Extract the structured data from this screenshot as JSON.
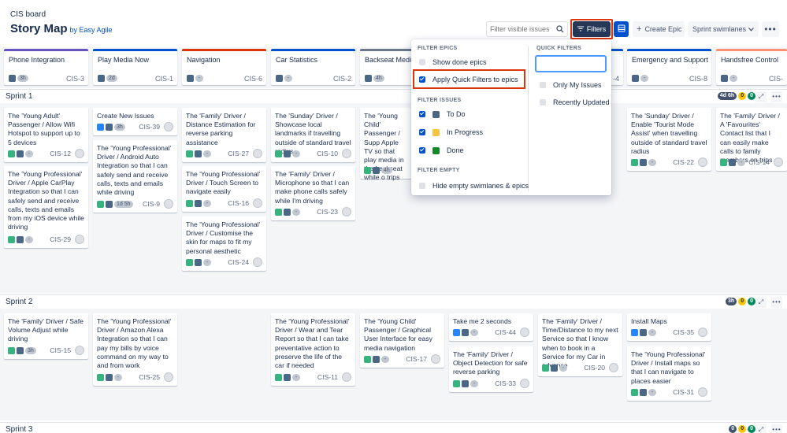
{
  "header": {
    "board_name": "CIS board",
    "title": "Story Map",
    "by_line": "by Easy Agile",
    "search_placeholder": "Filter visible issues",
    "filters_label": "Filters",
    "create_epic_label": "Create Epic",
    "swimlanes_label": "Sprint swimlanes"
  },
  "epics": [
    {
      "name": "Phone Integration",
      "color": "#6554c0",
      "pill": "3h",
      "key": "CIS-3"
    },
    {
      "name": "Play Media Now",
      "color": "#0052cc",
      "pill": "2d",
      "key": "CIS-1"
    },
    {
      "name": "Navigation",
      "color": "#de350b",
      "pill": "-",
      "key": "CIS-6"
    },
    {
      "name": "Car Statistics",
      "color": "#0052cc",
      "pill": "-",
      "key": "CIS-2"
    },
    {
      "name": "Backseat Media",
      "color": "#6b778c",
      "pill": "4h",
      "key": ""
    },
    {
      "name": "",
      "color": "#0052cc",
      "pill": "",
      "key": "-4"
    },
    {
      "name": "Emergency and Support",
      "color": "#0052cc",
      "pill": "-",
      "key": "CIS-8"
    },
    {
      "name": "Handsfree Control",
      "color": "#ff8f73",
      "pill": "-",
      "key": "CIS-"
    }
  ],
  "sprints": [
    {
      "name": "Sprint 1",
      "badges": [
        "4d 6h",
        "0",
        "0"
      ]
    },
    {
      "name": "Sprint 2",
      "badges": [
        "3h",
        "0",
        "0"
      ]
    },
    {
      "name": "Sprint 3",
      "badges": [
        "0",
        "0",
        "0"
      ]
    }
  ],
  "cards": {
    "c1": {
      "text": "The 'Young Adult' Passenger / Allow Wifi Hotspot to support up to 5 devices",
      "key": "CIS-12",
      "pill": "-"
    },
    "c2": {
      "text": "The 'Young Professional' Driver / Apple CarPlay Integration so that I can safely send and receive calls, texts and emails from my iOS device while driving",
      "key": "CIS-29",
      "pill": "-"
    },
    "c3": {
      "text": "Create New Issues",
      "key": "CIS-39",
      "pill": "3h"
    },
    "c4": {
      "text": "The 'Young Professional' Driver / Android Auto Integration so that I can safely send and receive calls, texts and emails while driving",
      "key": "CIS-9",
      "pill": "1d 5h"
    },
    "c5": {
      "text": "The 'Family' Driver / Distance Estimation for reverse parking assistance",
      "key": "CIS-27",
      "pill": "-"
    },
    "c6": {
      "text": "The 'Young Professional' Driver / Touch Screen to navigate easily",
      "key": "CIS-16",
      "pill": "-"
    },
    "c7": {
      "text": "The 'Young Professional' Driver / Customise the skin for maps to fit my personal aesthetic",
      "key": "CIS-24",
      "pill": "-"
    },
    "c8": {
      "text": "The 'Sunday' Driver / Showcase local landmarks if travelling outside of standard travel radius",
      "key": "CIS-10",
      "pill": "-"
    },
    "c9": {
      "text": "The 'Family' Driver / Microphone so that I can make phone calls safely while I'm driving",
      "key": "CIS-23",
      "pill": "-"
    },
    "c10": {
      "text": "The 'Young Child' Passenger / Supp Apple TV so that play media in the backseat while o trips",
      "key": "",
      "pill": "4h"
    },
    "c11": {
      "text": "The 'Sunday' Driver / Enable 'Tourist Mode Assist' when travelling outside of standard travel radius",
      "key": "CIS-22",
      "pill": "-"
    },
    "c12": {
      "text": "The 'Family' Driver / A 'Favourites' Contact list that I can easily make calls to family members on trips",
      "key": "CIS-14",
      "pill": "-"
    },
    "c13": {
      "text": "The 'Family' Driver / Safe Volume Adjust while driving",
      "key": "CIS-15",
      "pill": "3h"
    },
    "c14": {
      "text": "The 'Young Professional' Driver / Amazon Alexa Integration so that I can pay my bills by voice command on my way to and from work",
      "key": "CIS-25",
      "pill": "-"
    },
    "c15": {
      "text": "The 'Young Professional' Driver / Wear and Tear Report so that I can take preventative action to preserve the life of the car if needed",
      "key": "CIS-11",
      "pill": "-"
    },
    "c16": {
      "text": "The 'Young Child' Passenger / Graphical User Interface for easy media navigation",
      "key": "CIS-17",
      "pill": "-"
    },
    "c17": {
      "text": "Take me 2 seconds",
      "key": "CIS-44",
      "pill": "-"
    },
    "c18": {
      "text": "The 'Family' Driver / Object Detection for safe reverse parking",
      "key": "CIS-33",
      "pill": "-"
    },
    "c19": {
      "text": "The 'Family' Driver / Time/Distance to my next Service so that I know when to book in a Service for my Car in advance",
      "key": "CIS-20",
      "pill": "-"
    },
    "c20": {
      "text": "Install Maps",
      "key": "CIS-35",
      "pill": "-"
    },
    "c21": {
      "text": "The 'Young Professional' Driver / Install maps so that I can navigate to places easier",
      "key": "CIS-31",
      "pill": "-"
    }
  },
  "filters_menu": {
    "filter_epics_heading": "FILTER EPICS",
    "show_done_epics": "Show done epics",
    "apply_quick_filters": "Apply Quick Filters to epics",
    "filter_issues_heading": "FILTER ISSUES",
    "todo": "To Do",
    "in_progress": "In Progress",
    "done": "Done",
    "filter_empty_heading": "FILTER EMPTY",
    "hide_empty": "Hide empty swimlanes & epics",
    "quick_filters_heading": "QUICK FILTERS",
    "only_my_issues": "Only My Issues",
    "recently_updated": "Recently Updated",
    "colors": {
      "todo": "#4a6785",
      "in_progress": "#f6c342",
      "done": "#14892c"
    }
  }
}
